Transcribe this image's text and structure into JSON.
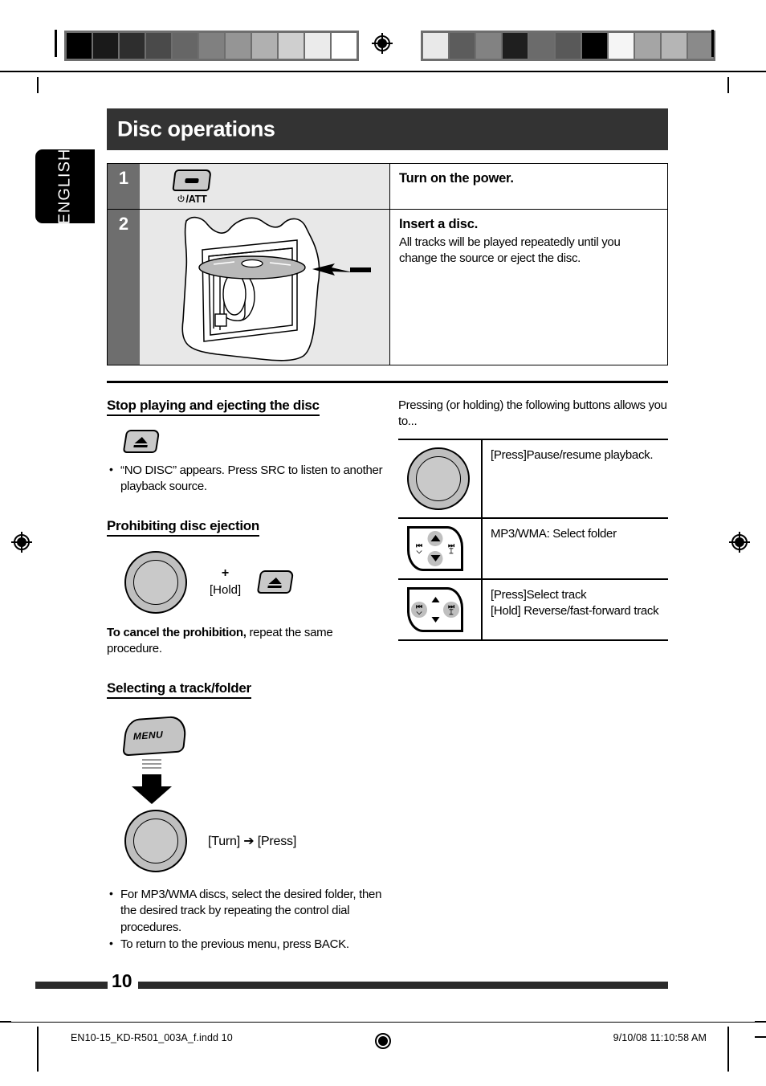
{
  "document": {
    "language_tab": "ENGLISH",
    "section_title": "Disc operations",
    "page_number": "10"
  },
  "steps": [
    {
      "number": "1",
      "icon": "power-att-button",
      "icon_label": "/ATT",
      "heading": "Turn on the power.",
      "body": ""
    },
    {
      "number": "2",
      "icon": "disc-insert-illustration",
      "heading": "Insert a disc.",
      "body": "All tracks will be played repeatedly until you change the source or eject the disc."
    }
  ],
  "left_column": {
    "section1": {
      "heading": "Stop playing and ejecting the disc",
      "icon": "eject-button",
      "bullets": [
        "“NO DISC” appears. Press SRC to listen to another playback source."
      ]
    },
    "section2": {
      "heading": "Prohibiting disc ejection",
      "plus": "+",
      "hold_label": "[Hold]",
      "note_bold": "To cancel the prohibition,",
      "note_rest": " repeat the same procedure."
    },
    "section3": {
      "heading": "Selecting a track/folder",
      "menu_button_label": "MENU",
      "dial_action": "[Turn]  ➔  [Press]",
      "bullets": [
        "For MP3/WMA discs, select the desired folder, then the desired track by repeating the control dial procedures.",
        "To return to the previous menu, press BACK."
      ]
    }
  },
  "right_column": {
    "intro": "Pressing (or holding) the following buttons allows you to...",
    "rows": [
      {
        "icon": "control-dial",
        "text_lines": [
          "[Press]Pause/resume playback."
        ]
      },
      {
        "icon": "dpad-updown",
        "text_lines": [
          "MP3/WMA: Select folder"
        ]
      },
      {
        "icon": "dpad-leftright",
        "text_lines": [
          "[Press]Select track",
          "[Hold] Reverse/fast-forward track"
        ]
      }
    ]
  },
  "footer": {
    "file_name": "EN10-15_KD-R501_003A_f.indd   10",
    "timestamp": "9/10/08   11:10:58 AM"
  },
  "calibration": {
    "left_swatches": [
      "#000000",
      "#1a1a1a",
      "#2e2e2e",
      "#4a4a4a",
      "#666666",
      "#808080",
      "#959595",
      "#b0b0b0",
      "#cfcfcf",
      "#ebebeb",
      "#ffffff"
    ],
    "right_swatches": [
      "#e9e9e9",
      "#5c5c5c",
      "#828282",
      "#1f1f1f",
      "#6b6b6b",
      "#595959",
      "#000000",
      "#f5f5f5",
      "#a5a5a5",
      "#b5b5b5",
      "#8a8a8a"
    ]
  },
  "colors": {
    "title_bar": "#333333",
    "step_number_bg": "#6e6e6e",
    "figure_bg": "#e8e8e8",
    "rule": "#2b2b2b"
  }
}
